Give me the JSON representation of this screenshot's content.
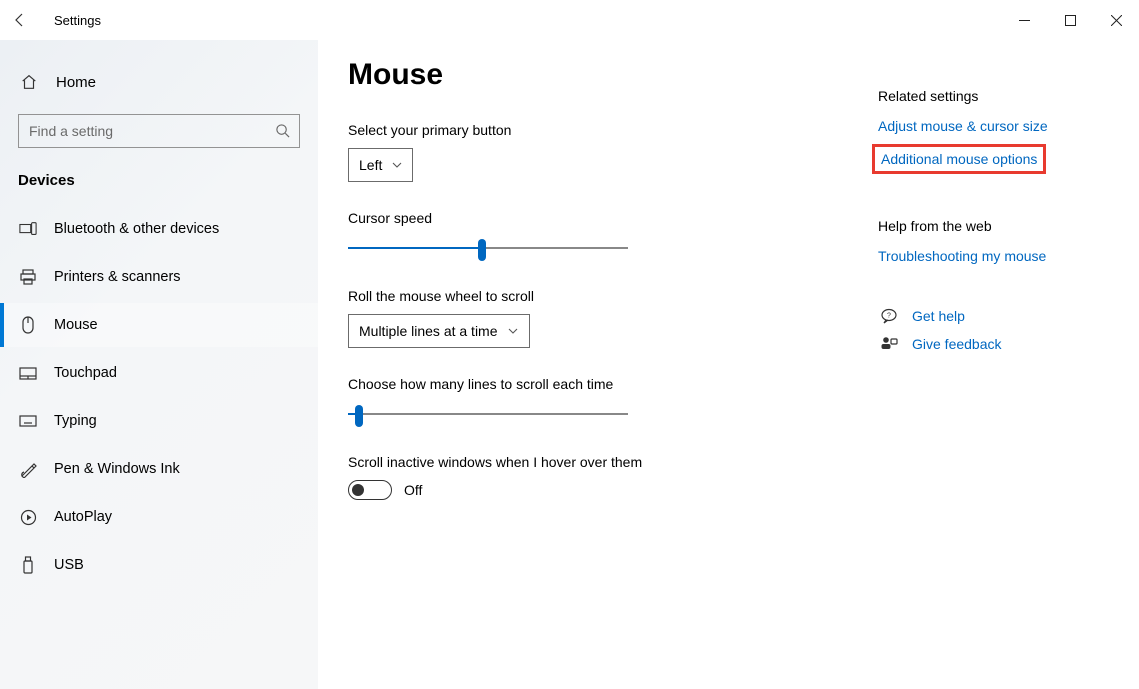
{
  "window": {
    "title": "Settings"
  },
  "sidebar": {
    "home": "Home",
    "search_placeholder": "Find a setting",
    "category": "Devices",
    "items": [
      {
        "label": "Bluetooth & other devices"
      },
      {
        "label": "Printers & scanners"
      },
      {
        "label": "Mouse"
      },
      {
        "label": "Touchpad"
      },
      {
        "label": "Typing"
      },
      {
        "label": "Pen & Windows Ink"
      },
      {
        "label": "AutoPlay"
      },
      {
        "label": "USB"
      }
    ]
  },
  "main": {
    "title": "Mouse",
    "primary_label": "Select your primary button",
    "primary_value": "Left",
    "cursor_speed_label": "Cursor speed",
    "cursor_speed_pct": 48,
    "wheel_label": "Roll the mouse wheel to scroll",
    "wheel_value": "Multiple lines at a time",
    "lines_label": "Choose how many lines to scroll each time",
    "lines_pct": 4,
    "inactive_label": "Scroll inactive windows when I hover over them",
    "inactive_value": "Off"
  },
  "right": {
    "related_heading": "Related settings",
    "related_links": [
      "Adjust mouse & cursor size",
      "Additional mouse options"
    ],
    "help_heading": "Help from the web",
    "help_links": [
      "Troubleshooting my mouse"
    ],
    "get_help": "Get help",
    "give_feedback": "Give feedback"
  }
}
